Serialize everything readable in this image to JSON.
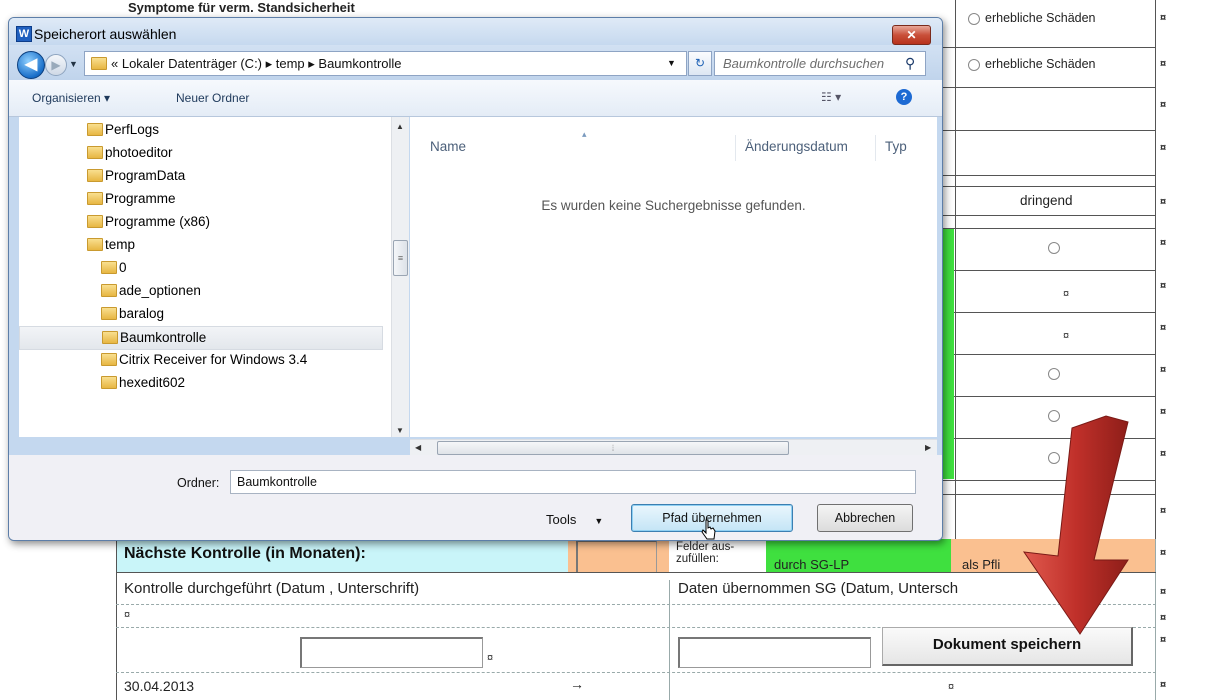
{
  "document": {
    "header_row": "Symptome für verm. Standsicherheit",
    "option_1": "erhebliche Schäden",
    "option_2": "erhebliche Schäden",
    "urgency": "dringend",
    "next_check_label": "Nächste Kontrolle (in Monaten):",
    "fill_in_label_1": "Felder aus-",
    "fill_in_label_2": "zufüllen:",
    "by_sg": "durch SG-LP",
    "as_pfl": "als Pfli",
    "control_done": "Kontrolle durchgeführt (Datum , Unterschrift)",
    "data_taken": "Daten übernommen SG (Datum, Untersch",
    "date_value": "30.04.2013",
    "save_button": "Dokument speichern",
    "pilcrow": "¤",
    "colors": {
      "green": "#3fe03f",
      "orange": "#fac090",
      "cyan": "#c9f5f9",
      "arrow": "#c0302a"
    }
  },
  "dialog": {
    "title": "Speicherort auswählen",
    "app_icon": "W",
    "close_label": "✕",
    "breadcrumb": "« Lokaler Datenträger (C:) ▸ temp ▸ Baumkontrolle",
    "search_placeholder": "Baumkontrolle durchsuchen",
    "toolbar": {
      "organize": "Organisieren ▾",
      "new_folder": "Neuer Ordner",
      "help": "?"
    },
    "tree": [
      {
        "label": "PerfLogs",
        "indent": 1,
        "selected": false
      },
      {
        "label": "photoeditor",
        "indent": 1,
        "selected": false
      },
      {
        "label": "ProgramData",
        "indent": 1,
        "selected": false
      },
      {
        "label": "Programme",
        "indent": 1,
        "selected": false
      },
      {
        "label": "Programme (x86)",
        "indent": 1,
        "selected": false
      },
      {
        "label": "temp",
        "indent": 1,
        "selected": false
      },
      {
        "label": "0",
        "indent": 2,
        "selected": false
      },
      {
        "label": "ade_optionen",
        "indent": 2,
        "selected": false
      },
      {
        "label": "baralog",
        "indent": 2,
        "selected": false
      },
      {
        "label": "Baumkontrolle",
        "indent": 2,
        "selected": true
      },
      {
        "label": "Citrix Receiver for Windows 3.4",
        "indent": 2,
        "selected": false
      },
      {
        "label": "hexedit602",
        "indent": 2,
        "selected": false
      }
    ],
    "columns": {
      "name": "Name",
      "date": "Änderungsdatum",
      "type": "Typ"
    },
    "empty_message": "Es wurden keine Suchergebnisse gefunden.",
    "folder_label": "Ordner:",
    "folder_value": "Baumkontrolle",
    "tools_label": "Tools",
    "ok_button": "Pfad übernehmen",
    "cancel_button": "Abbrechen"
  }
}
